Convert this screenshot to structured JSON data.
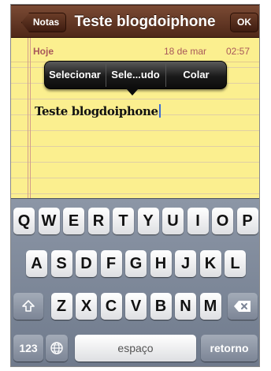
{
  "navbar": {
    "back_label": "Notas",
    "title": "Teste blogdoiphone",
    "ok_label": "OK"
  },
  "note": {
    "day": "Hoje",
    "date": "18 de mar",
    "time": "02:57",
    "text": "Teste blogdoiphone"
  },
  "edit_menu": {
    "items": [
      "Selecionar",
      "Sele...udo",
      "Colar"
    ]
  },
  "keyboard": {
    "row1": [
      "Q",
      "W",
      "E",
      "R",
      "T",
      "Y",
      "U",
      "I",
      "O",
      "P"
    ],
    "row2": [
      "A",
      "S",
      "D",
      "F",
      "G",
      "H",
      "J",
      "K",
      "L"
    ],
    "row3": [
      "Z",
      "X",
      "C",
      "V",
      "B",
      "N",
      "M"
    ],
    "numbers_label": "123",
    "space_label": "espaço",
    "return_label": "retorno"
  },
  "colors": {
    "navbar": "#5e3422",
    "paper": "#fbef8f",
    "header_text": "#a8585a",
    "keyboard_bg": "#7f899b"
  },
  "icons": [
    "shift-icon",
    "backspace-icon",
    "globe-icon"
  ]
}
